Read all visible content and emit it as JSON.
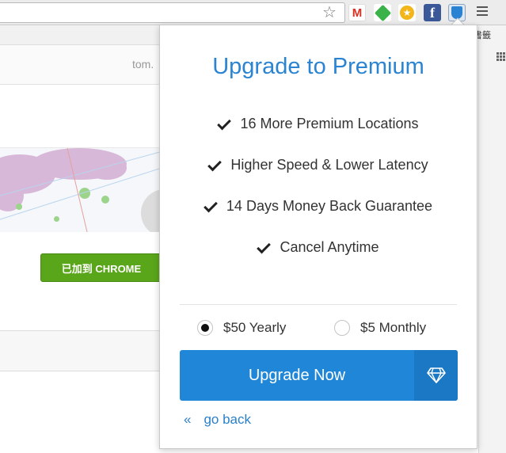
{
  "browser": {
    "extensions": [
      "gmail-icon",
      "evernote-icon",
      "star-extension-icon",
      "facebook-icon",
      "vpn-shield-icon"
    ],
    "gmail_letter": "M",
    "facebook_letter": "f",
    "right_label": "書籤"
  },
  "page": {
    "user_text": "tom.",
    "chrome_button": "已加到 CHROME"
  },
  "popup": {
    "title": "Upgrade to Premium",
    "features": [
      "16 More Premium Locations",
      "Higher Speed & Lower Latency",
      "14 Days Money Back Guarantee",
      "Cancel Anytime"
    ],
    "plans": [
      {
        "label": "$50 Yearly",
        "selected": true
      },
      {
        "label": "$5 Monthly",
        "selected": false
      }
    ],
    "upgrade_label": "Upgrade Now",
    "back_arrow": "«",
    "back_label": "go back"
  },
  "colors": {
    "accent": "#2a84d2",
    "button": "#1f86d8",
    "chrome_green": "#5aa61a"
  }
}
